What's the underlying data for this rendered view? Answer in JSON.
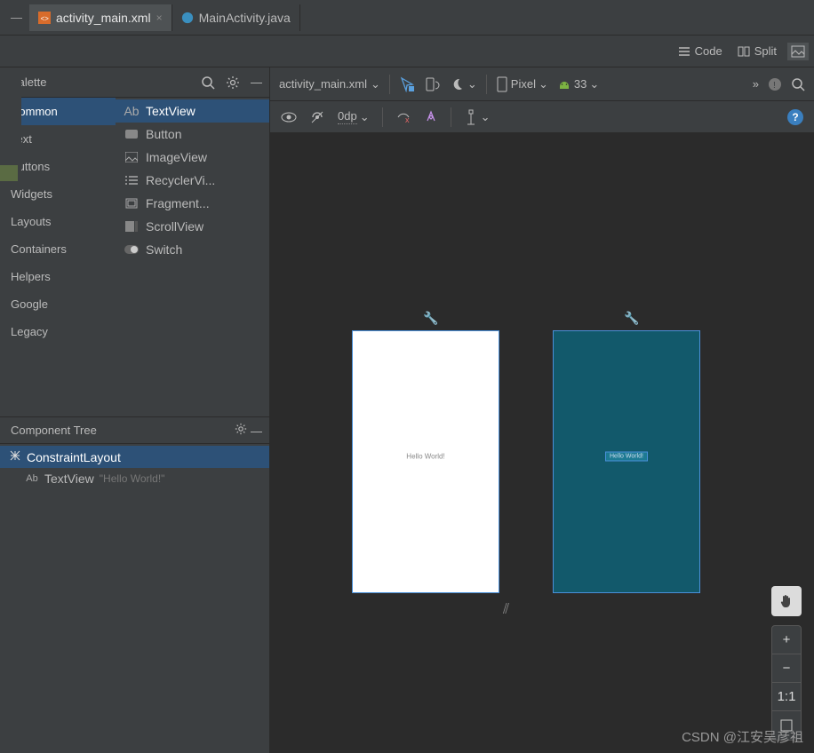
{
  "tabs": {
    "main_xml": "activity_main.xml",
    "main_java": "MainActivity.java"
  },
  "view_tabs": {
    "code": "Code",
    "split": "Split"
  },
  "palette": {
    "title": "Palette",
    "categories": [
      "Common",
      "Text",
      "Buttons",
      "Widgets",
      "Layouts",
      "Containers",
      "Helpers",
      "Google",
      "Legacy"
    ],
    "widgets": [
      "TextView",
      "Button",
      "ImageView",
      "RecyclerVi...",
      "Fragment...",
      "ScrollView",
      "Switch"
    ]
  },
  "component_tree": {
    "title": "Component Tree",
    "root": "ConstraintLayout",
    "child": "TextView",
    "child_preview": "\"Hello World!\""
  },
  "design_toolbar": {
    "file": "activity_main.xml",
    "device": "Pixel",
    "api": "33"
  },
  "subtoolbar": {
    "margin": "0dp"
  },
  "canvas": {
    "hello_text": "Hello World!",
    "zoom_11": "1:1",
    "zoom_plus": "+",
    "zoom_minus": "−"
  },
  "watermark": "CSDN @江安吴彦祖"
}
